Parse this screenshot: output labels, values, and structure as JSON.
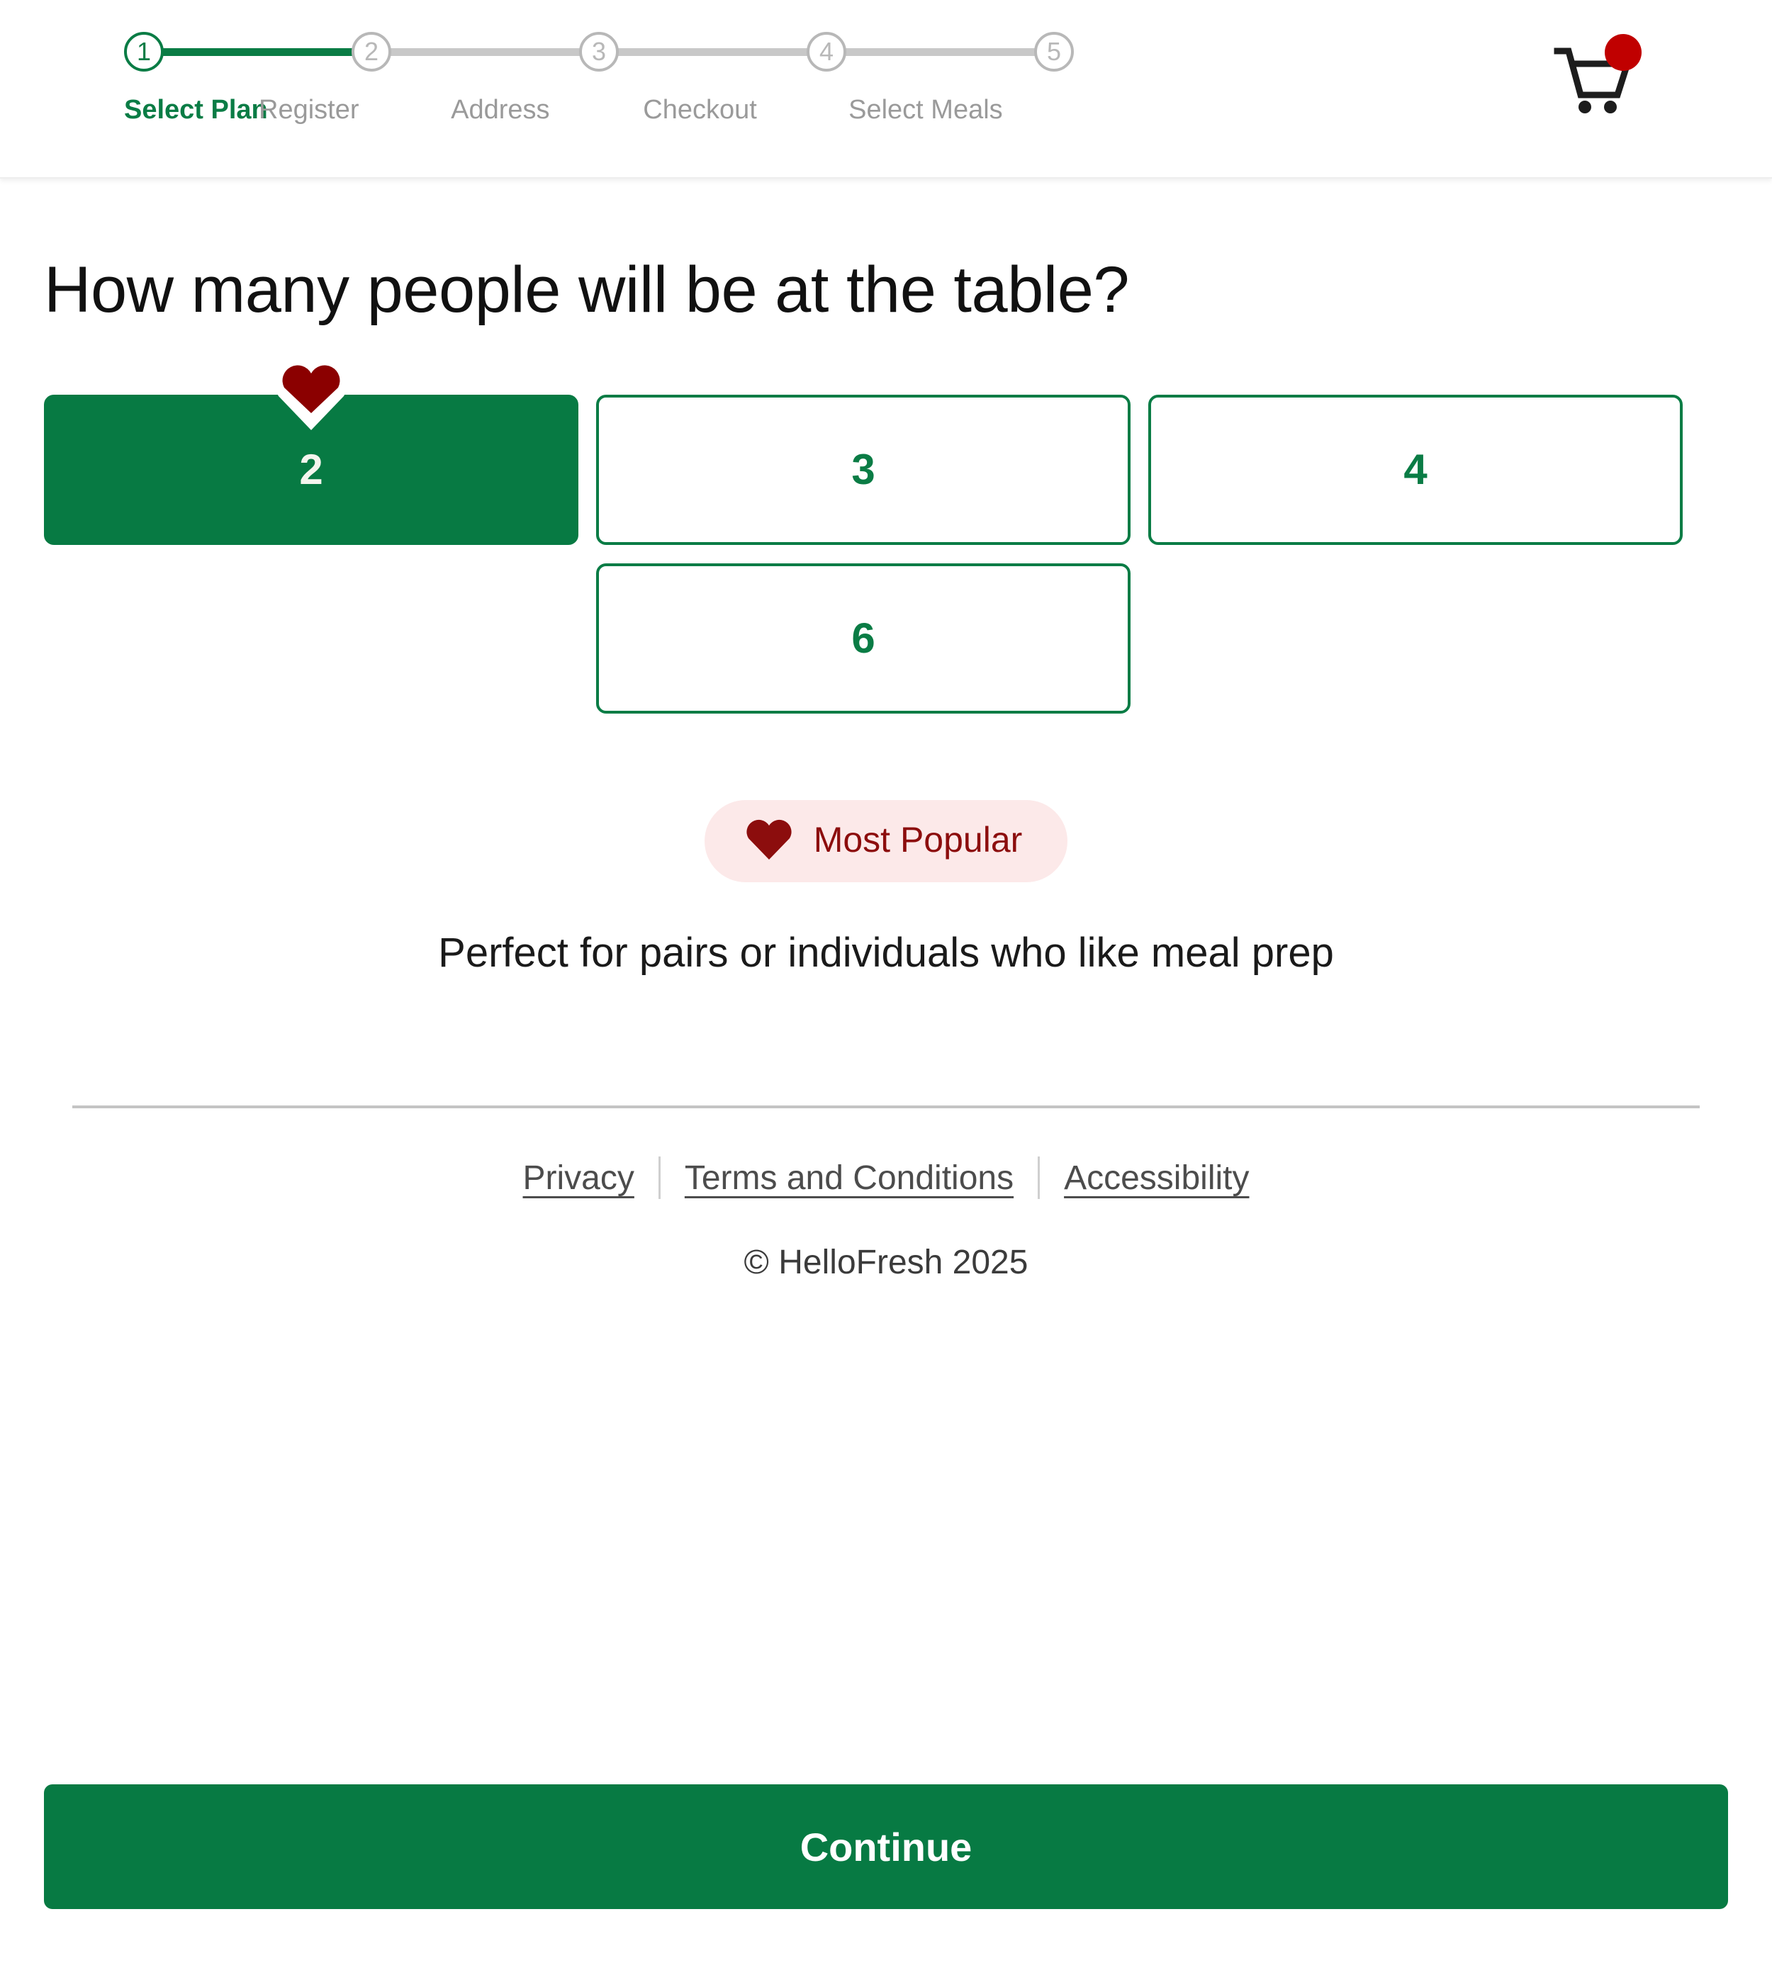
{
  "colors": {
    "brand_green": "#077a43",
    "step_inactive_gray": "#b8b8b8",
    "badge_red": "#8c0d0d",
    "badge_pink_bg": "#fce9e9",
    "cart_dot_red": "#c00000"
  },
  "header": {
    "steps": [
      {
        "number": "1",
        "label": "Select Plan",
        "state": "active"
      },
      {
        "number": "2",
        "label": "Register",
        "state": "inactive"
      },
      {
        "number": "3",
        "label": "Address",
        "state": "inactive"
      },
      {
        "number": "4",
        "label": "Checkout",
        "state": "inactive"
      },
      {
        "number": "5",
        "label": "Select Meals",
        "state": "inactive"
      }
    ],
    "cart": {
      "icon": "shopping-cart-icon",
      "badge_icon": "cart-notification-dot"
    }
  },
  "main": {
    "headline": "How many people will be at the table?",
    "options": [
      {
        "value": "2",
        "selected": true,
        "heart_badge": true
      },
      {
        "value": "3",
        "selected": false,
        "heart_badge": false
      },
      {
        "value": "4",
        "selected": false,
        "heart_badge": false
      },
      {
        "value": "6",
        "selected": false,
        "heart_badge": false
      }
    ],
    "popular_badge": {
      "icon": "heart-icon",
      "label": "Most Popular"
    },
    "description": "Perfect for pairs or individuals who like meal prep"
  },
  "footer": {
    "links": [
      {
        "label": "Privacy"
      },
      {
        "label": "Terms and Conditions"
      },
      {
        "label": "Accessibility"
      }
    ],
    "copyright": "© HelloFresh 2025"
  },
  "cta": {
    "label": "Continue"
  }
}
